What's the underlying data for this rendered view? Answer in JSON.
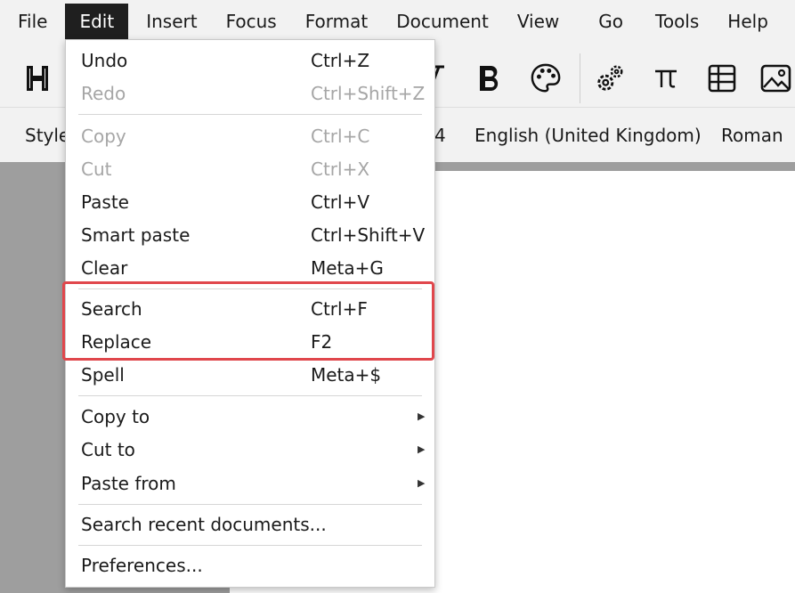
{
  "menubar": {
    "items": [
      "File",
      "Edit",
      "Insert",
      "Focus",
      "Format",
      "Document",
      "View",
      "Go",
      "Tools",
      "Help"
    ],
    "active": "Edit"
  },
  "toolbar": {
    "icons": [
      "heading-icon",
      "italic-icon",
      "bold-icon",
      "palette-icon",
      "gears-icon",
      "pi-icon",
      "table-icon",
      "image-icon"
    ]
  },
  "modebar": {
    "style_label": "Style",
    "size_value": "4",
    "language": "English (United Kingdom)",
    "font": "Roman"
  },
  "edit_menu": {
    "items": [
      {
        "label": "Undo",
        "shortcut": "Ctrl+Z",
        "enabled": true
      },
      {
        "label": "Redo",
        "shortcut": "Ctrl+Shift+Z",
        "enabled": false
      },
      {
        "label": "Copy",
        "shortcut": "Ctrl+C",
        "enabled": false
      },
      {
        "label": "Cut",
        "shortcut": "Ctrl+X",
        "enabled": false
      },
      {
        "label": "Paste",
        "shortcut": "Ctrl+V",
        "enabled": true
      },
      {
        "label": "Smart paste",
        "shortcut": "Ctrl+Shift+V",
        "enabled": true
      },
      {
        "label": "Clear",
        "shortcut": "Meta+G",
        "enabled": true
      },
      {
        "label": "Search",
        "shortcut": "Ctrl+F",
        "enabled": true
      },
      {
        "label": "Replace",
        "shortcut": "F2",
        "enabled": true
      },
      {
        "label": "Spell",
        "shortcut": "Meta+$",
        "enabled": true
      },
      {
        "label": "Copy to",
        "shortcut": "",
        "enabled": true,
        "submenu": true
      },
      {
        "label": "Cut to",
        "shortcut": "",
        "enabled": true,
        "submenu": true
      },
      {
        "label": "Paste from",
        "shortcut": "",
        "enabled": true,
        "submenu": true
      },
      {
        "label": "Search recent documents...",
        "shortcut": "",
        "enabled": true
      },
      {
        "label": "Preferences...",
        "shortcut": "",
        "enabled": true
      }
    ]
  },
  "colors": {
    "highlight_border": "#e0474c",
    "active_menu_bg": "#1f1f1f",
    "disabled_text": "#a6a6a6"
  }
}
